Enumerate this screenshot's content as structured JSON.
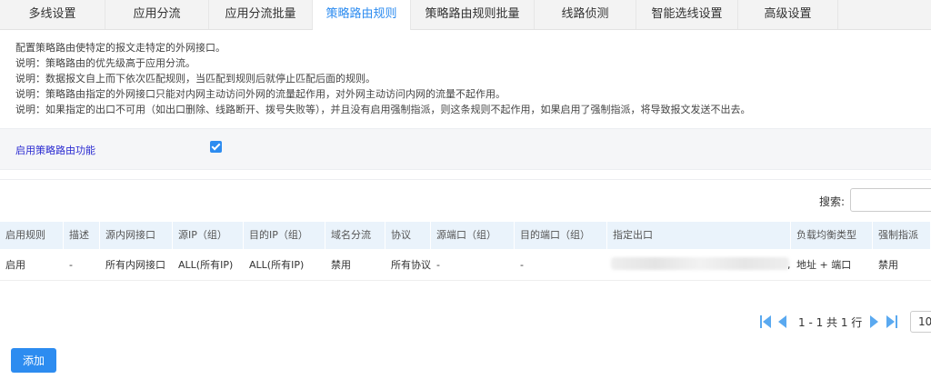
{
  "tabs": [
    {
      "label": "多线设置"
    },
    {
      "label": "应用分流"
    },
    {
      "label": "应用分流批量"
    },
    {
      "label": "策略路由规则",
      "active": true
    },
    {
      "label": "策略路由规则批量"
    },
    {
      "label": "线路侦测"
    },
    {
      "label": "智能选线设置"
    },
    {
      "label": "高级设置"
    }
  ],
  "description": [
    "配置策略路由使特定的报文走特定的外网接口。",
    "说明：策略路由的优先级高于应用分流。",
    "说明：数据报文自上而下依次匹配规则，当匹配到规则后就停止匹配后面的规则。",
    "说明：策略路由指定的外网接口只能对内网主动访问外网的流量起作用，对外网主动访问内网的流量不起作用。",
    "说明：如果指定的出口不可用（如出口删除、线路断开、拨号失败等），并且没有启用强制指派，则这条规则不起作用，如果启用了强制指派，将导致报文发送不出去。"
  ],
  "enable": {
    "label": "启用策略路由功能",
    "checked": true
  },
  "search": {
    "label": "搜索:",
    "value": ""
  },
  "table": {
    "columns": [
      "启用规则",
      "描述",
      "源内网接口",
      "源IP（组）",
      "目的IP（组）",
      "域名分流",
      "协议",
      "源端口（组）",
      "目的端口（组）",
      "指定出口",
      "负载均衡类型",
      "强制指派"
    ],
    "rows": [
      [
        "启用",
        "-",
        "所有内网接口",
        "ALL(所有IP)",
        "ALL(所有IP)",
        "禁用",
        "所有协议",
        "-",
        "-",
        "",
        "地址 + 端口",
        "禁用"
      ]
    ]
  },
  "pagination": {
    "info": "1 - 1 共 1 行",
    "page_size": "10"
  },
  "add_button": "添加",
  "colors": {
    "accent": "#2d8cf0",
    "header_bg": "#eaf3fb"
  }
}
